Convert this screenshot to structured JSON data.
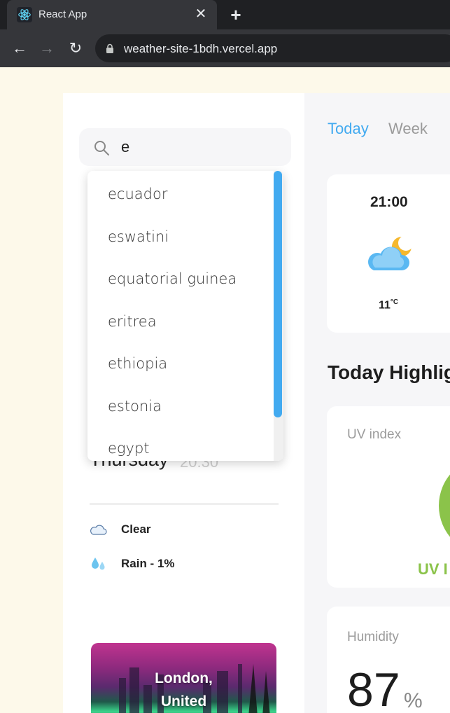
{
  "browser": {
    "tab_title": "React App",
    "tab_close": "✕",
    "new_tab": "+",
    "url": "weather-site-1bdh.vercel.app"
  },
  "search": {
    "value": "e",
    "suggestions": [
      "ecuador",
      "eswatini",
      "equatorial guinea",
      "eritrea",
      "ethiopia",
      "estonia",
      "egypt"
    ]
  },
  "current": {
    "day": "Thursday",
    "time": "20:30",
    "conditions": [
      {
        "icon": "cloud-icon",
        "label": "Clear"
      },
      {
        "icon": "raindrops-icon",
        "label": "Rain - 1%"
      }
    ]
  },
  "location": {
    "line1": "London,",
    "line2": "United"
  },
  "tabs": {
    "today": "Today",
    "week": "Week",
    "active": "today"
  },
  "hourly": {
    "time": "21:00",
    "icon": "moon-cloud-icon",
    "temp": "11",
    "unit": "°C"
  },
  "highlights": {
    "title": "Today Highlig",
    "uv": {
      "label": "UV index",
      "status": "UV I"
    },
    "humidity": {
      "label": "Humidity",
      "value": "87",
      "unit": "%"
    }
  },
  "colors": {
    "accent": "#42aaf0",
    "uv_good": "#8bc34a",
    "page_bg": "#fdf9ea"
  }
}
